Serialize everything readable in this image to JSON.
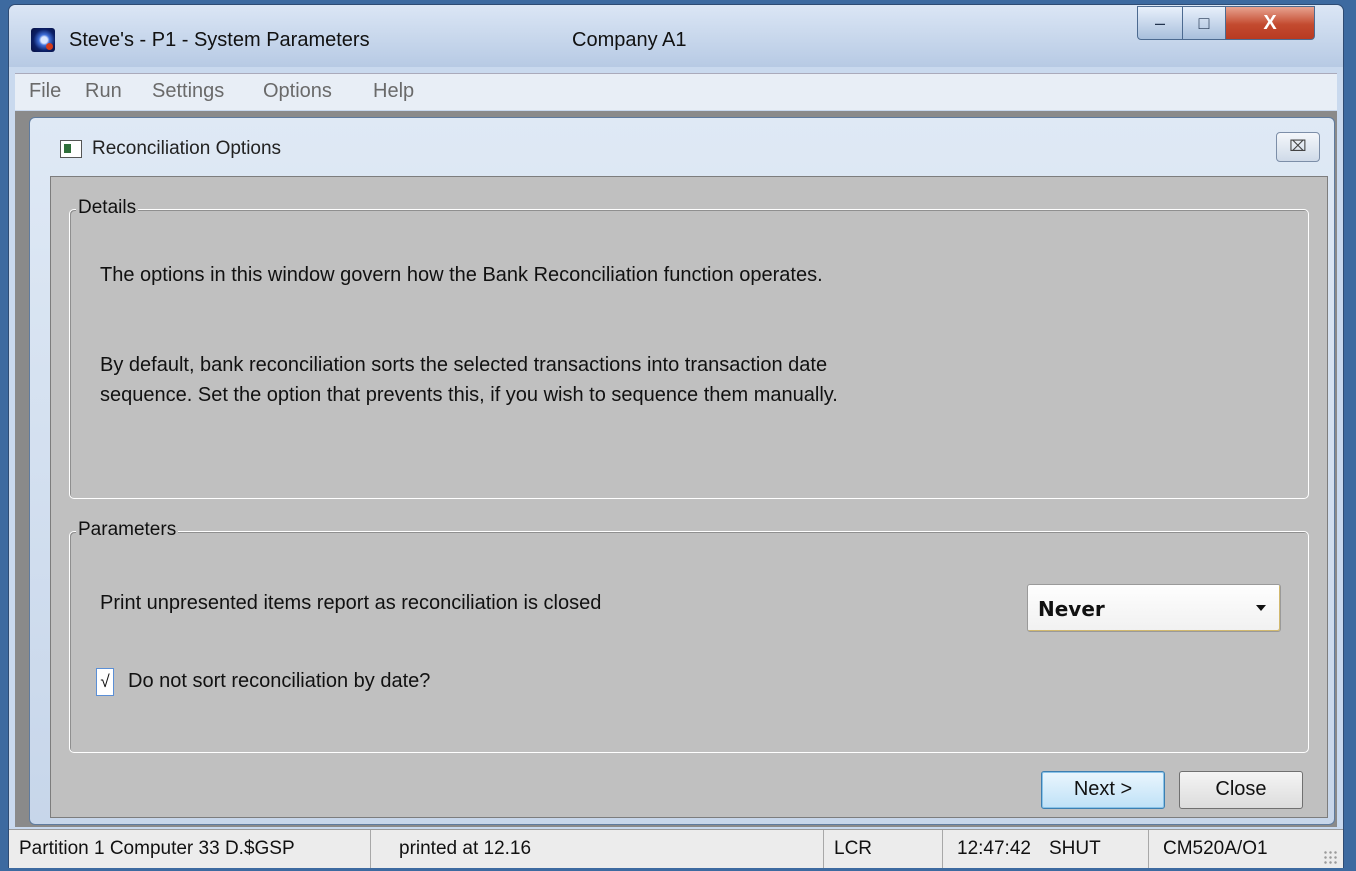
{
  "window": {
    "title": "Steve's - P1 - System Parameters",
    "company": "Company A1",
    "controls": {
      "minimize": "–",
      "maximize": "□",
      "close": "X"
    }
  },
  "menubar": {
    "items": [
      "File",
      "Run",
      "Settings",
      "Options",
      "Help"
    ]
  },
  "dialog": {
    "title": "Reconciliation Options",
    "close_symbol": "⌧",
    "details": {
      "legend": "Details",
      "paragraph1": "The options in this window govern how the Bank Reconciliation function operates.",
      "paragraph2": "By default, bank reconciliation sorts the selected transactions into transaction date sequence. Set the option that prevents this, if you wish to sequence them manually."
    },
    "parameters": {
      "legend": "Parameters",
      "print_label": "Print unpresented items report as reconciliation is closed",
      "print_value": "Never",
      "sort_checkbox_mark": "√",
      "sort_label": "Do not sort reconciliation by date?"
    },
    "buttons": {
      "next": "Next >",
      "close": "Close"
    }
  },
  "statusbar": {
    "partition": "Partition 1 Computer 33 D.$GSP",
    "printed": "printed at 12.16",
    "mode": "LCR",
    "time": "12:47:42",
    "state": "SHUT",
    "program": "CM520A/O1"
  },
  "colors": {
    "desktop": "#3d6aa0",
    "panel": "#c0c0c0",
    "accent": "#3c7fb1",
    "title_close": "#c34a2f"
  }
}
